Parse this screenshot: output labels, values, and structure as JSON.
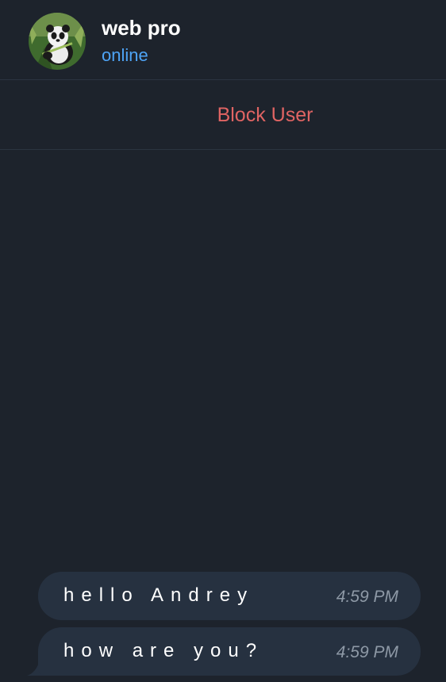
{
  "chat": {
    "contact_name": "web pro",
    "contact_status": "online",
    "avatar_icon": "panda-avatar"
  },
  "actions": {
    "block_user_label": "Block User"
  },
  "messages": [
    {
      "text": "hello Andrey",
      "time": "4:59 PM"
    },
    {
      "text": "how are you?",
      "time": "4:59 PM"
    }
  ],
  "colors": {
    "background": "#1d232c",
    "bubble": "#263140",
    "status_online": "#4ea4f6",
    "danger": "#e06463",
    "timestamp": "#8e99a6"
  }
}
